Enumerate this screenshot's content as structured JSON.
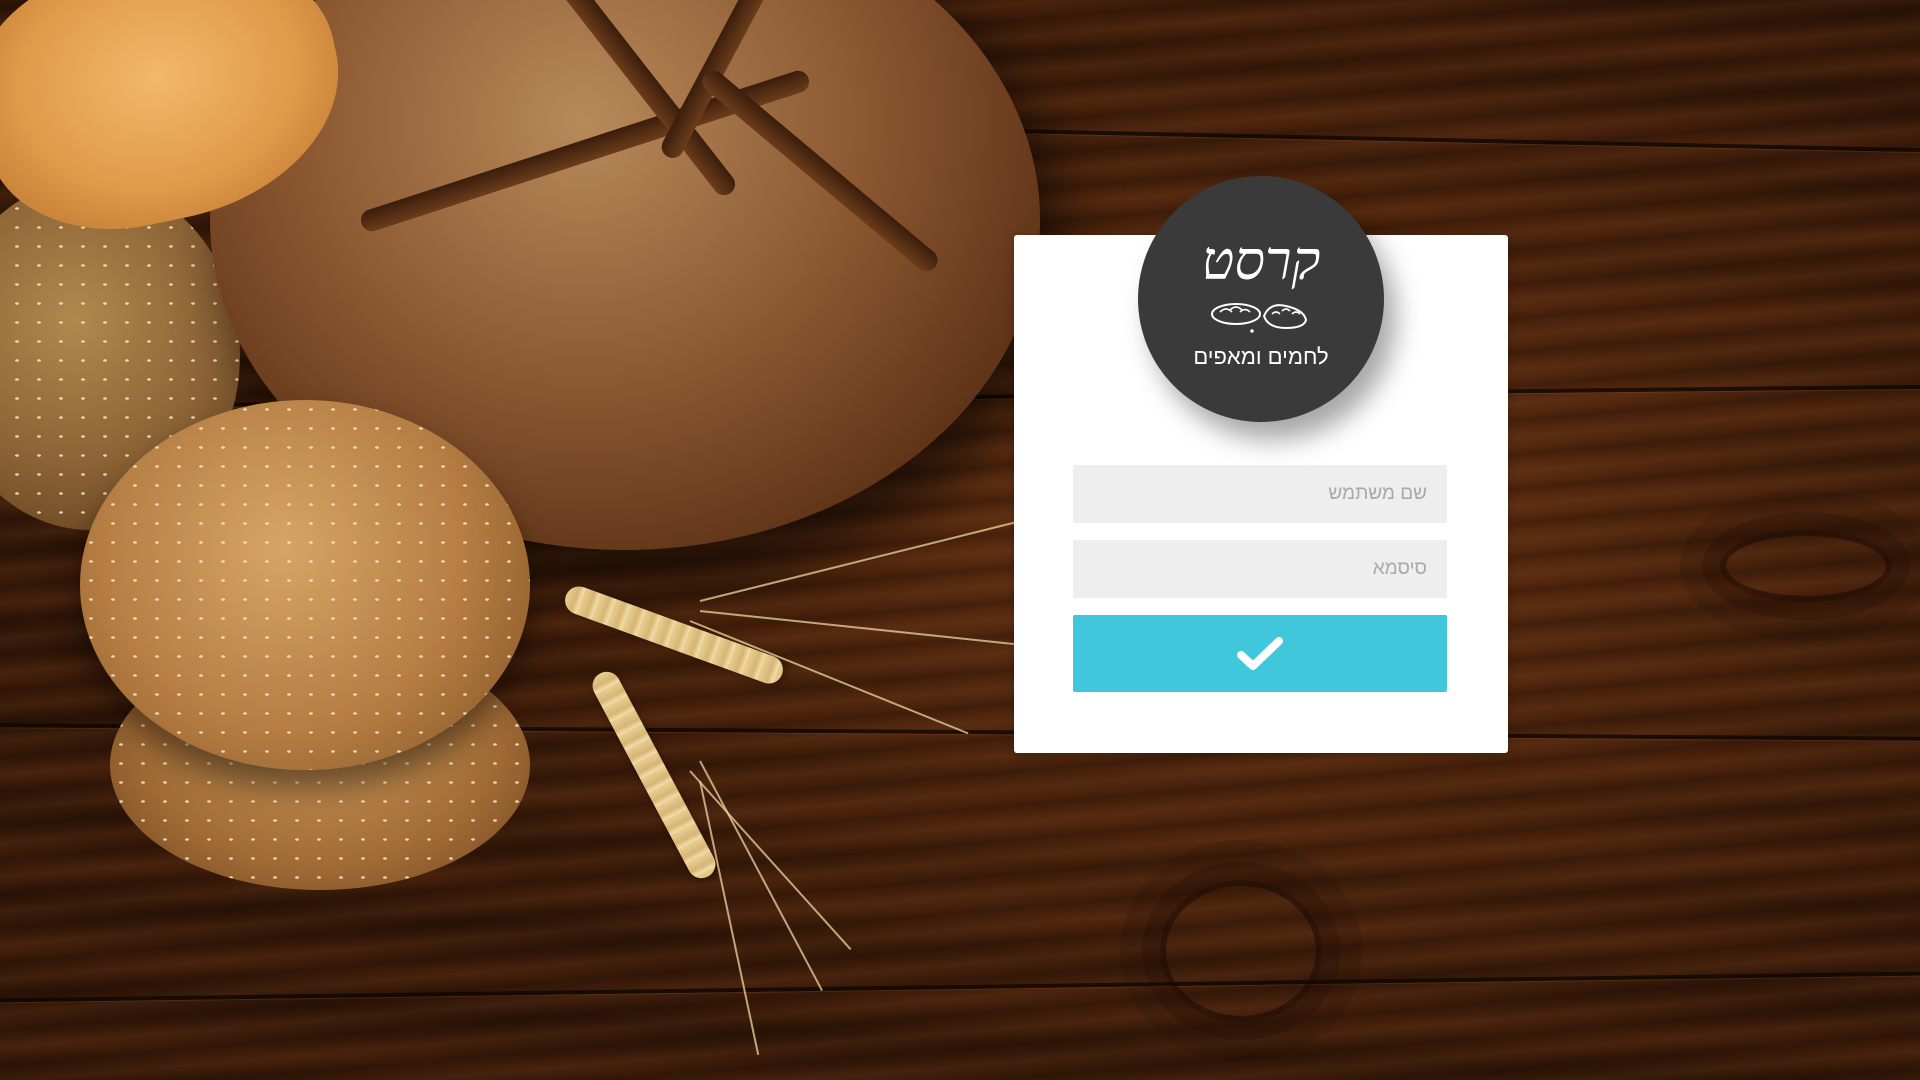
{
  "brand": {
    "wordmark": "קרסט",
    "tagline": "לחמים ומאפים",
    "badge_color": "#3a3a3a"
  },
  "login": {
    "username_placeholder": "שם משתמש",
    "password_placeholder": "סיסמא",
    "submit_icon": "check-icon",
    "submit_color": "#40c7dc"
  }
}
